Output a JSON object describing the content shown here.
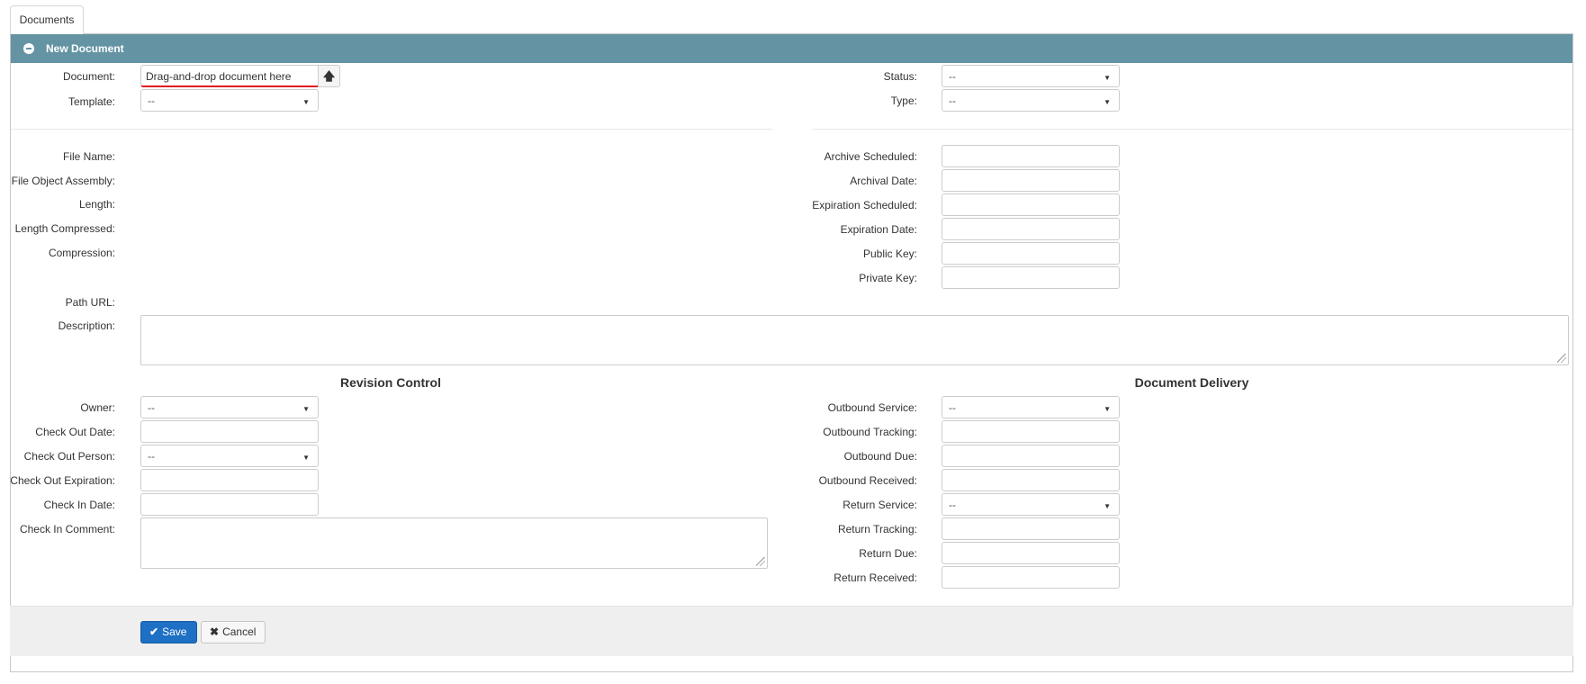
{
  "tabs": [
    {
      "label": "Documents"
    }
  ],
  "panel": {
    "title": "New Document"
  },
  "top_left": {
    "document_label": "Document:",
    "document_placeholder": "Drag-and-drop document here",
    "template_label": "Template:",
    "template_value": "--"
  },
  "top_right": {
    "status_label": "Status:",
    "status_value": "--",
    "type_label": "Type:",
    "type_value": "--"
  },
  "file_info": {
    "file_name_label": "File Name:",
    "assembly_label": "File Object Assembly:",
    "length_label": "Length:",
    "length_compressed_label": "Length Compressed:",
    "compression_label": "Compression:",
    "path_url_label": "Path URL:",
    "description_label": "Description:"
  },
  "archive": {
    "archive_scheduled_label": "Archive Scheduled:",
    "archival_date_label": "Archival Date:",
    "expiration_scheduled_label": "Expiration Scheduled:",
    "expiration_date_label": "Expiration Date:",
    "public_key_label": "Public Key:",
    "private_key_label": "Private Key:"
  },
  "revision": {
    "title": "Revision Control",
    "owner_label": "Owner:",
    "owner_value": "--",
    "check_out_date_label": "Check Out Date:",
    "check_out_person_label": "Check Out Person:",
    "check_out_person_value": "--",
    "check_out_expiration_label": "Check Out Expiration:",
    "check_in_date_label": "Check In Date:",
    "check_in_comment_label": "Check In Comment:"
  },
  "delivery": {
    "title": "Document Delivery",
    "outbound_service_label": "Outbound Service:",
    "outbound_service_value": "--",
    "outbound_tracking_label": "Outbound Tracking:",
    "outbound_due_label": "Outbound Due:",
    "outbound_received_label": "Outbound Received:",
    "return_service_label": "Return Service:",
    "return_service_value": "--",
    "return_tracking_label": "Return Tracking:",
    "return_due_label": "Return Due:",
    "return_received_label": "Return Received:"
  },
  "footer": {
    "save_label": "Save",
    "cancel_label": "Cancel"
  },
  "colors": {
    "header": "#6494a4",
    "primary_button": "#1d70c4",
    "required_underline": "#e31b23"
  }
}
